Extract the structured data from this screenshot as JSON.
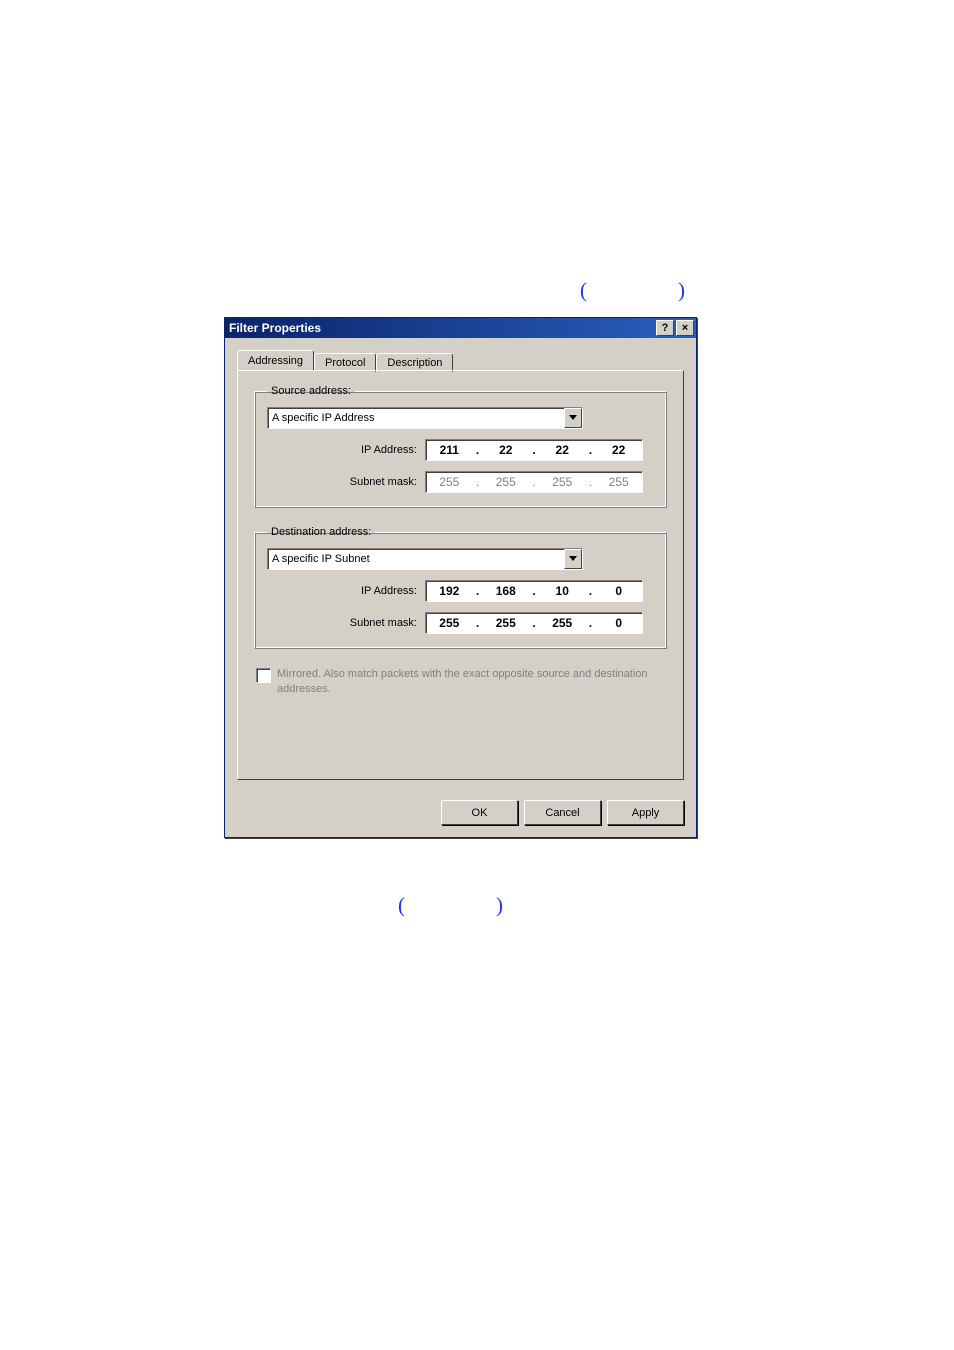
{
  "page_marks": {
    "paren_open": "(",
    "paren_close": ")"
  },
  "dialog": {
    "title": "Filter Properties",
    "help_glyph": "?",
    "close_glyph": "×",
    "tabs": [
      {
        "label": "Addressing"
      },
      {
        "label": "Protocol"
      },
      {
        "label": "Description"
      }
    ],
    "source": {
      "legend": "Source address:",
      "dropdown": "A specific IP Address",
      "ip_label": "IP Address:",
      "ip": [
        "211",
        "22",
        "22",
        "22"
      ],
      "mask_label": "Subnet mask:",
      "mask": [
        "255",
        "255",
        "255",
        "255"
      ]
    },
    "destination": {
      "legend": "Destination address:",
      "dropdown": "A specific IP Subnet",
      "ip_label": "IP Address:",
      "ip": [
        "192",
        "168",
        "10",
        "0"
      ],
      "mask_label": "Subnet mask:",
      "mask": [
        "255",
        "255",
        "255",
        "0"
      ]
    },
    "mirrored": {
      "label": "Mirrored. Also match packets with the exact opposite source and destination addresses."
    },
    "buttons": {
      "ok": "OK",
      "cancel": "Cancel",
      "apply": "Apply"
    }
  }
}
